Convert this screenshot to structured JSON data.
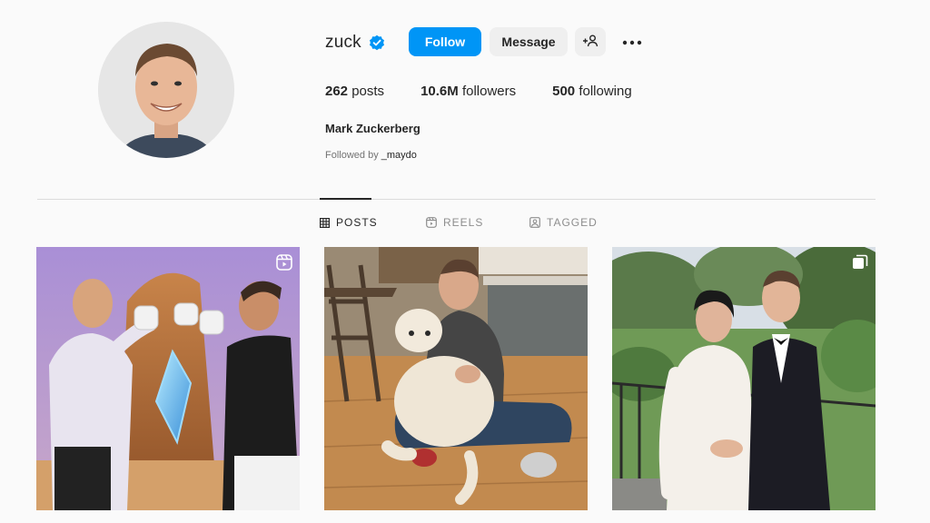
{
  "profile": {
    "username": "zuck",
    "full_name": "Mark Zuckerberg",
    "followed_by_prefix": "Followed by",
    "followed_by_user": "_maydo",
    "verified": true
  },
  "buttons": {
    "follow": "Follow",
    "message": "Message",
    "add_user_icon": "add-person-icon",
    "more_icon": "more-horizontal-icon"
  },
  "stats": {
    "posts_count": "262",
    "posts_label": "posts",
    "followers_count": "10.6M",
    "followers_label": "followers",
    "following_count": "500",
    "following_label": "following"
  },
  "tabs": [
    {
      "label": "POSTS",
      "icon": "grid-icon",
      "active": true
    },
    {
      "label": "REELS",
      "icon": "reels-icon",
      "active": false
    },
    {
      "label": "TAGGED",
      "icon": "tagged-icon",
      "active": false
    }
  ],
  "colors": {
    "accent": "#0095f6",
    "background": "#fafafa",
    "verified": "#0095f6"
  },
  "posts": [
    {
      "badge_icon": "reels-icon"
    },
    {
      "badge_icon": null
    },
    {
      "badge_icon": "carousel-icon"
    }
  ]
}
